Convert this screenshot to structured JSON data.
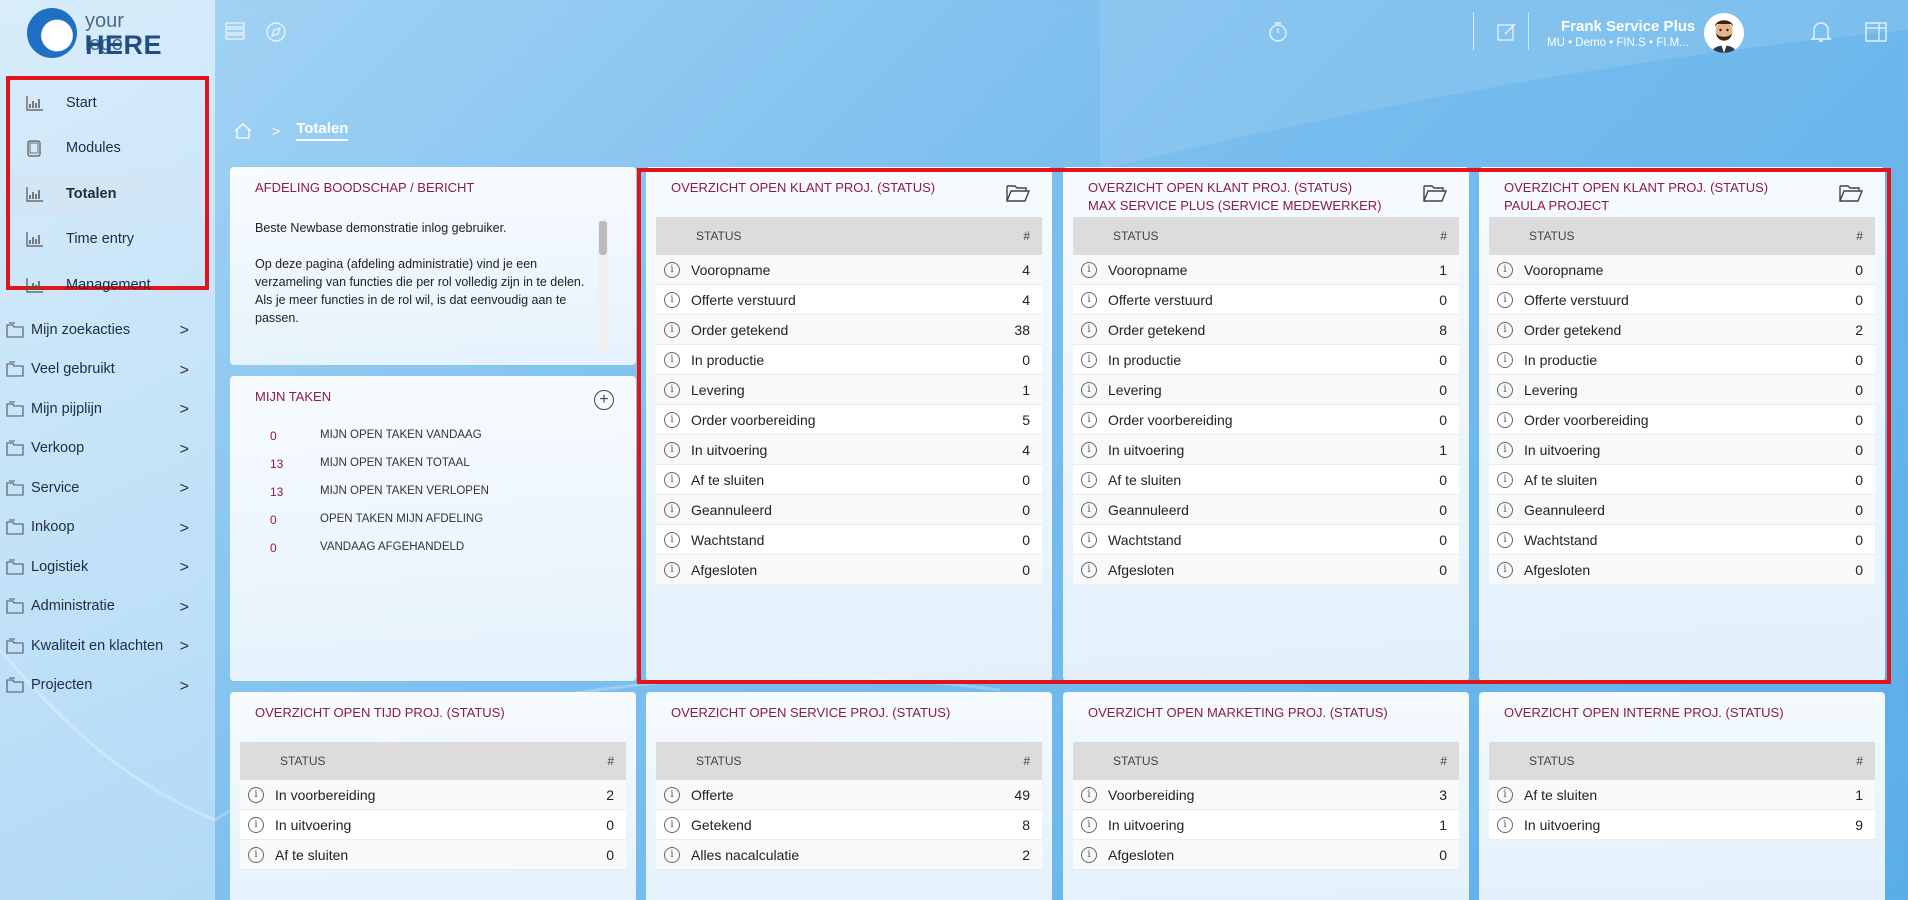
{
  "logo": {
    "line1": "your logo",
    "line2": "HERE"
  },
  "sidebar": {
    "top_items": [
      {
        "label": "Start",
        "icon": "chart-icon"
      },
      {
        "label": "Modules",
        "icon": "tablet-icon"
      },
      {
        "label": "Totalen",
        "icon": "chart-icon",
        "active": true
      },
      {
        "label": "Time entry",
        "icon": "chart-icon"
      },
      {
        "label": "Management",
        "icon": "chart-icon"
      }
    ],
    "nav_items": [
      {
        "label": "Mijn zoekacties"
      },
      {
        "label": "Veel gebruikt"
      },
      {
        "label": "Mijn pijplijn"
      },
      {
        "label": "Verkoop"
      },
      {
        "label": "Service"
      },
      {
        "label": "Inkoop"
      },
      {
        "label": "Logistiek"
      },
      {
        "label": "Administratie"
      },
      {
        "label": "Kwaliteit en klachten"
      },
      {
        "label": "Projecten"
      }
    ],
    "chevron": ">"
  },
  "user": {
    "name": "Frank Service Plus",
    "sub": "MU • Demo • FIN.S • FI.M..."
  },
  "breadcrumb": {
    "separator": ">",
    "current": "Totalen"
  },
  "message_panel": {
    "title": "AFDELING BOODSCHAP / BERICHT",
    "p1": "Beste Newbase demonstratie inlog gebruiker.",
    "p2": "Op deze pagina (afdeling administratie) vind je een verzameling van functies die per rol volledig zijn in te delen.",
    "p3": "Als je meer functies in de rol wil, is dat eenvoudig aan te passen."
  },
  "tasks_panel": {
    "title": "MIJN TAKEN",
    "items": [
      {
        "count": "0",
        "label": "MIJN OPEN TAKEN VANDAAG"
      },
      {
        "count": "13",
        "label": "MIJN OPEN TAKEN TOTAAL"
      },
      {
        "count": "13",
        "label": "MIJN OPEN TAKEN VERLOPEN"
      },
      {
        "count": "0",
        "label": "OPEN TAKEN MIJN AFDELING"
      },
      {
        "count": "0",
        "label": "VANDAAG AFGEHANDELD"
      }
    ]
  },
  "table_head": {
    "status": "STATUS",
    "hash": "#"
  },
  "status_panels": [
    {
      "title1": "OVERZICHT OPEN KLANT PROJ. (STATUS)",
      "title2": "",
      "rows": [
        {
          "label": "Vooropname",
          "value": "4"
        },
        {
          "label": "Offerte verstuurd",
          "value": "4"
        },
        {
          "label": "Order getekend",
          "value": "38"
        },
        {
          "label": "In productie",
          "value": "0"
        },
        {
          "label": "Levering",
          "value": "1"
        },
        {
          "label": "Order voorbereiding",
          "value": "5"
        },
        {
          "label": "In uitvoering",
          "value": "4"
        },
        {
          "label": "Af te sluiten",
          "value": "0"
        },
        {
          "label": "Geannuleerd",
          "value": "0"
        },
        {
          "label": "Wachtstand",
          "value": "0"
        },
        {
          "label": "Afgesloten",
          "value": "0"
        }
      ]
    },
    {
      "title1": "OVERZICHT OPEN KLANT PROJ. (STATUS)",
      "title2": "MAX SERVICE PLUS (SERVICE MEDEWERKER)",
      "rows": [
        {
          "label": "Vooropname",
          "value": "1"
        },
        {
          "label": "Offerte verstuurd",
          "value": "0"
        },
        {
          "label": "Order getekend",
          "value": "8"
        },
        {
          "label": "In productie",
          "value": "0"
        },
        {
          "label": "Levering",
          "value": "0"
        },
        {
          "label": "Order voorbereiding",
          "value": "0"
        },
        {
          "label": "In uitvoering",
          "value": "1"
        },
        {
          "label": "Af te sluiten",
          "value": "0"
        },
        {
          "label": "Geannuleerd",
          "value": "0"
        },
        {
          "label": "Wachtstand",
          "value": "0"
        },
        {
          "label": "Afgesloten",
          "value": "0"
        }
      ]
    },
    {
      "title1": "OVERZICHT OPEN KLANT PROJ. (STATUS)",
      "title2": "PAULA PROJECT",
      "rows": [
        {
          "label": "Vooropname",
          "value": "0"
        },
        {
          "label": "Offerte verstuurd",
          "value": "0"
        },
        {
          "label": "Order getekend",
          "value": "2"
        },
        {
          "label": "In productie",
          "value": "0"
        },
        {
          "label": "Levering",
          "value": "0"
        },
        {
          "label": "Order voorbereiding",
          "value": "0"
        },
        {
          "label": "In uitvoering",
          "value": "0"
        },
        {
          "label": "Af te sluiten",
          "value": "0"
        },
        {
          "label": "Geannuleerd",
          "value": "0"
        },
        {
          "label": "Wachtstand",
          "value": "0"
        },
        {
          "label": "Afgesloten",
          "value": "0"
        }
      ]
    }
  ],
  "bottom_panels": [
    {
      "title1": "OVERZICHT OPEN TIJD PROJ. (STATUS)",
      "rows": [
        {
          "label": "In voorbereiding",
          "value": "2"
        },
        {
          "label": "In uitvoering",
          "value": "0"
        },
        {
          "label": "Af te sluiten",
          "value": "0"
        }
      ]
    },
    {
      "title1": "OVERZICHT OPEN SERVICE PROJ. (STATUS)",
      "rows": [
        {
          "label": "Offerte",
          "value": "49"
        },
        {
          "label": "Getekend",
          "value": "8"
        },
        {
          "label": "Alles nacalculatie",
          "value": "2"
        }
      ]
    },
    {
      "title1": "OVERZICHT OPEN MARKETING PROJ. (STATUS)",
      "rows": [
        {
          "label": "Voorbereiding",
          "value": "3"
        },
        {
          "label": "In uitvoering",
          "value": "1"
        },
        {
          "label": "Afgesloten",
          "value": "0"
        }
      ]
    },
    {
      "title1": "OVERZICHT OPEN INTERNE PROJ. (STATUS)",
      "rows": [
        {
          "label": "Af te sluiten",
          "value": "1"
        },
        {
          "label": "In uitvoering",
          "value": "9"
        }
      ]
    }
  ],
  "colors": {
    "accent": "#8a1c48",
    "highlight": "#e0151b",
    "background": "#7ec0ef"
  }
}
